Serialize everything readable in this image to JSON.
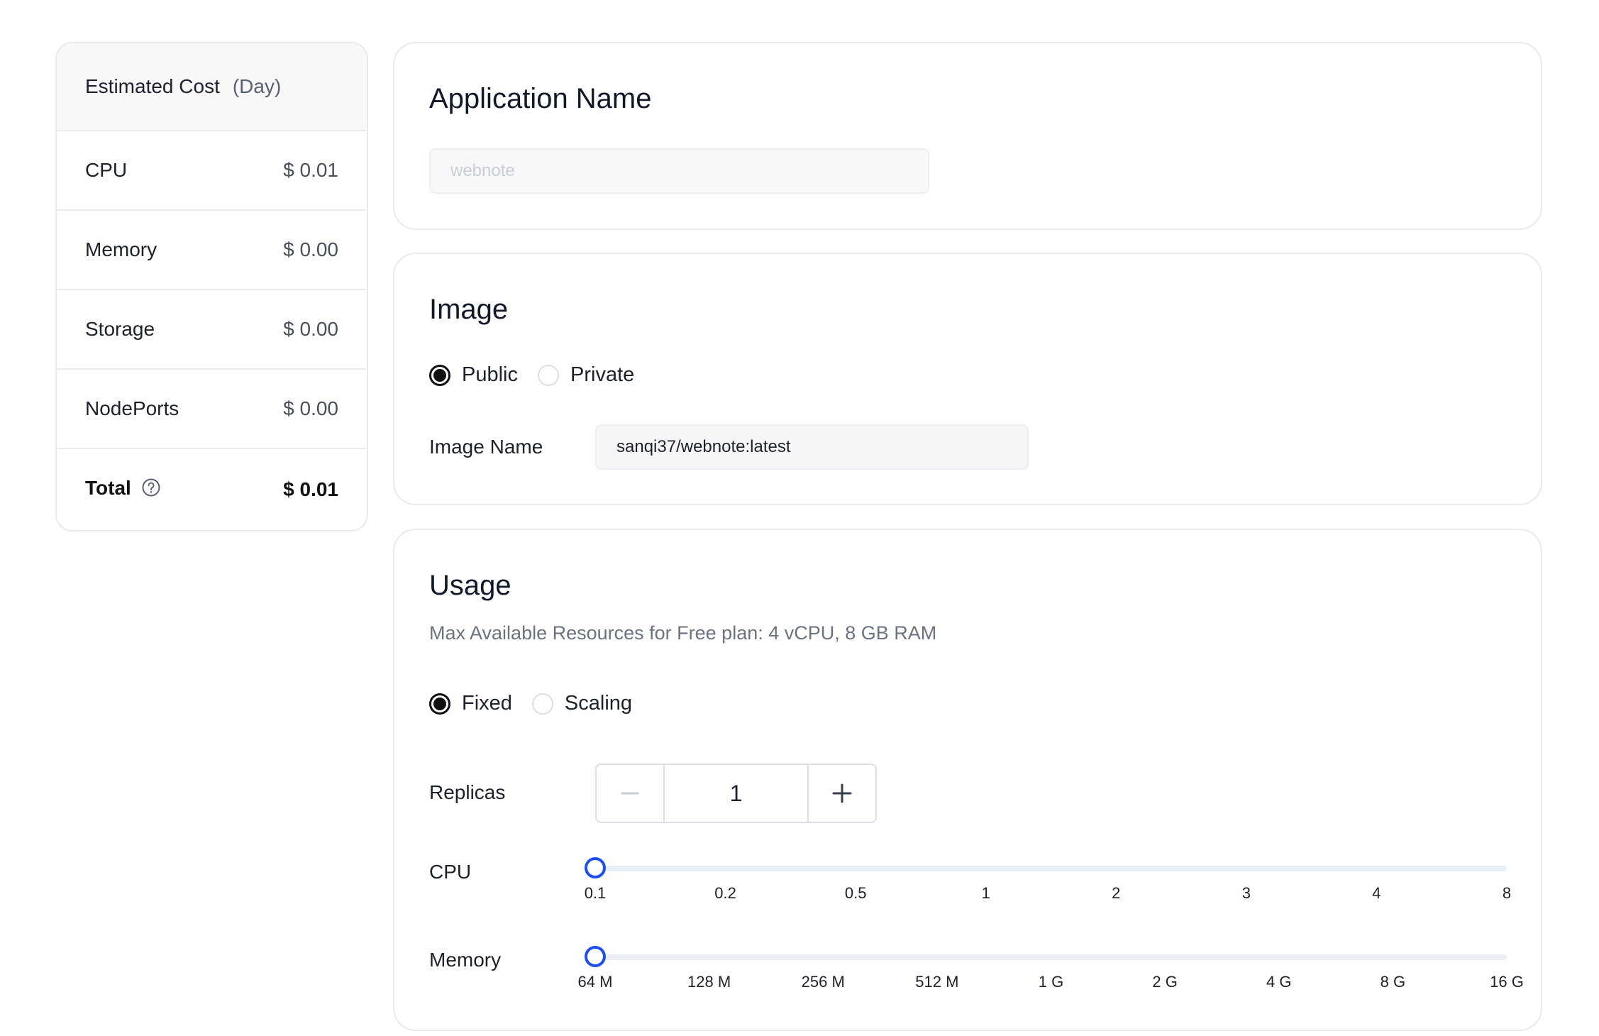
{
  "cost": {
    "title": "Estimated Cost",
    "unit": "(Day)",
    "rows": [
      {
        "label": "CPU",
        "value": "$ 0.01"
      },
      {
        "label": "Memory",
        "value": "$ 0.00"
      },
      {
        "label": "Storage",
        "value": "$ 0.00"
      },
      {
        "label": "NodePorts",
        "value": "$ 0.00"
      }
    ],
    "total": {
      "label": "Total",
      "value": "$ 0.01"
    }
  },
  "app": {
    "title": "Application Name",
    "name_value": "",
    "name_placeholder": "webnote"
  },
  "image": {
    "title": "Image",
    "options": [
      "Public",
      "Private"
    ],
    "selected": "Public",
    "name_label": "Image Name",
    "name_value": "sanqi37/webnote:latest"
  },
  "usage": {
    "title": "Usage",
    "description": "Max Available Resources for Free plan: 4 vCPU, 8 GB RAM",
    "modes": [
      "Fixed",
      "Scaling"
    ],
    "selected_mode": "Fixed",
    "replicas_label": "Replicas",
    "replicas": "1",
    "cpu": {
      "label": "CPU",
      "ticks": [
        "0.1",
        "0.2",
        "0.5",
        "1",
        "2",
        "3",
        "4",
        "8"
      ],
      "selected_index": 0
    },
    "memory": {
      "label": "Memory",
      "ticks": [
        "64 M",
        "128 M",
        "256 M",
        "512 M",
        "1 G",
        "2 G",
        "4 G",
        "8 G",
        "16 G"
      ],
      "selected_index": 0
    }
  },
  "colors": {
    "accent": "#1f4ef0",
    "border": "#e8eaee",
    "text": "#1d2129"
  }
}
